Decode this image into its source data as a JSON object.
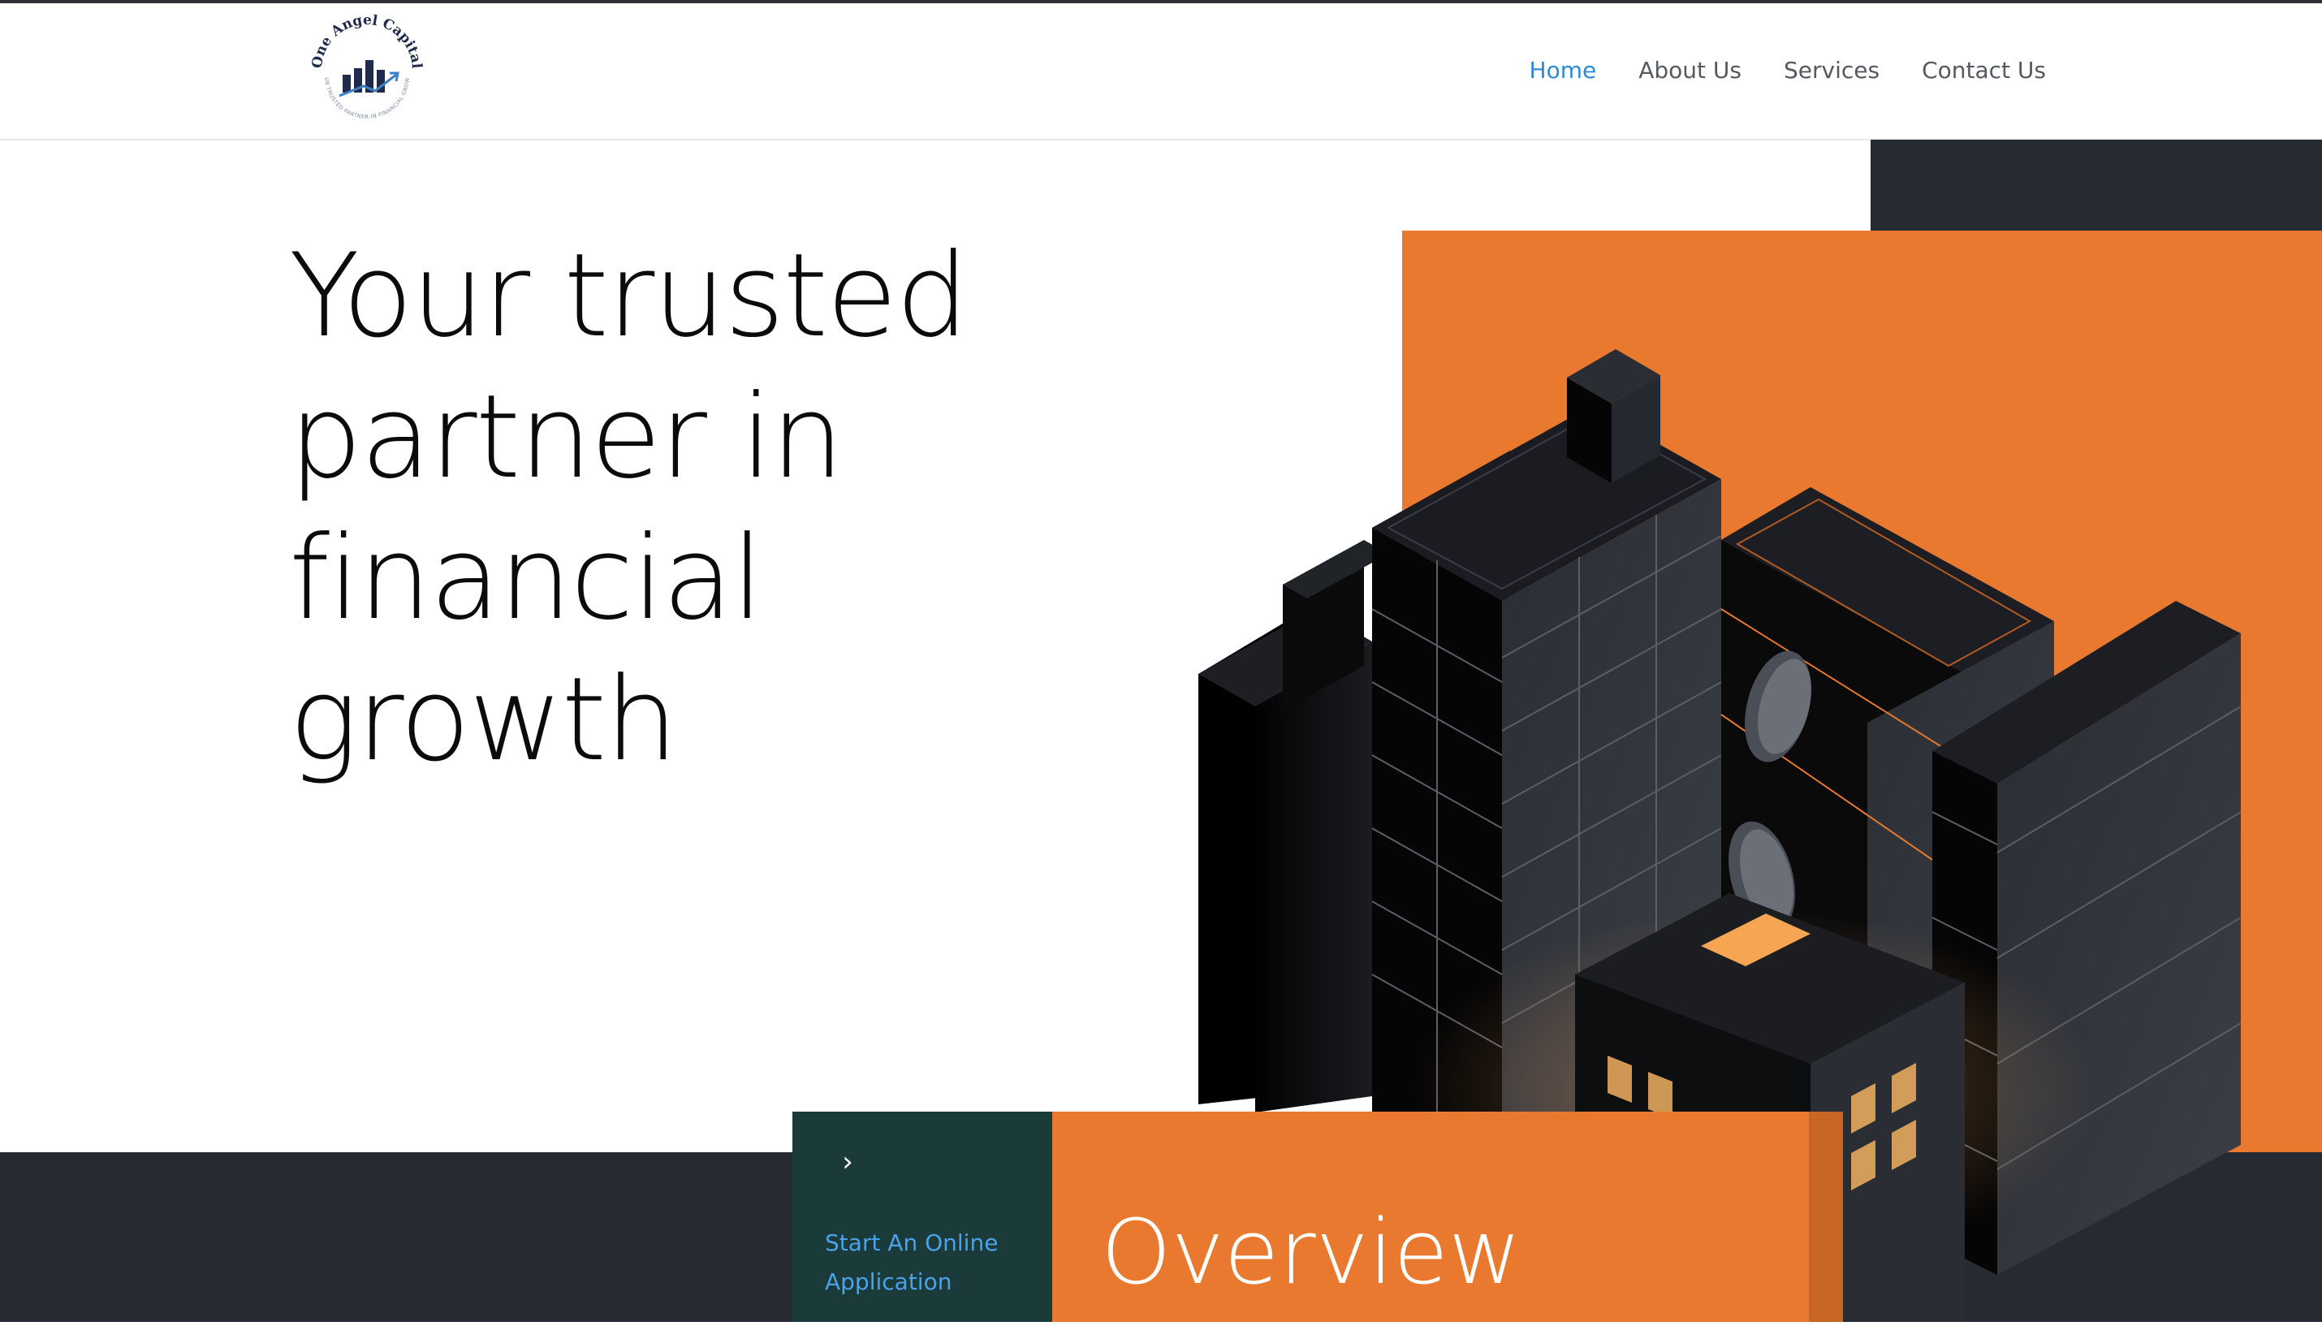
{
  "brand": {
    "name": "One Angel Capital",
    "tagline": "YOUR TRUSTED PARTNER IN FINANCIAL GROWTH"
  },
  "nav": {
    "items": [
      {
        "label": "Home",
        "active": true
      },
      {
        "label": "About Us",
        "active": false
      },
      {
        "label": "Services",
        "active": false
      },
      {
        "label": "Contact Us",
        "active": false
      }
    ]
  },
  "hero": {
    "title_lines": [
      "Your trusted",
      "partner in",
      "financial growth"
    ]
  },
  "cta": {
    "chevron_icon": "chevron-right-icon",
    "label": "Start An Online Application"
  },
  "overview": {
    "title": "Overview"
  },
  "colors": {
    "accent_orange": "#e8792f",
    "dark": "#262a33",
    "teal_dark": "#1b3a3a",
    "link_blue": "#2e8bd8"
  }
}
